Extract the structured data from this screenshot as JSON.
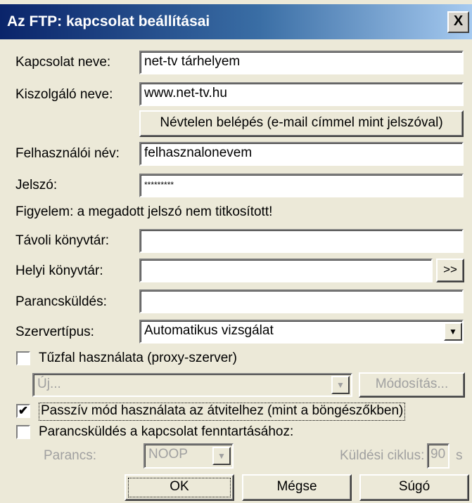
{
  "window": {
    "title": "Az FTP: kapcsolat beállításai",
    "close_label": "X"
  },
  "form": {
    "connection_name": {
      "label": "Kapcsolat neve:",
      "value": "net-tv tárhelyem"
    },
    "server_name": {
      "label": "Kiszolgáló neve:",
      "value": "www.net-tv.hu"
    },
    "anonymous_button": "Névtelen belépés (e-mail címmel mint jelszóval)",
    "username": {
      "label": "Felhasználói név:",
      "value": "felhasznalonevem"
    },
    "password": {
      "label": "Jelszó:",
      "value": "*********"
    },
    "warning": "Figyelem: a megadott jelszó nem titkosított!",
    "remote_dir": {
      "label": "Távoli könyvtár:",
      "value": ""
    },
    "local_dir": {
      "label": "Helyi könyvtár:",
      "value": "",
      "browse_label": ">>"
    },
    "command": {
      "label": "Parancsküldés:",
      "value": ""
    },
    "server_type": {
      "label": "Szervertípus:",
      "value": "Automatikus vizsgálat"
    },
    "firewall": {
      "label": "Tűzfal használata (proxy-szerver)",
      "checked": false,
      "profile_value": "Új...",
      "modify_label": "Módosítás..."
    },
    "passive": {
      "label": "Passzív mód használata az átvitelhez (mint a böngészőkben)",
      "checked": true
    },
    "keepalive": {
      "label": "Parancsküldés a kapcsolat fenntartásához:",
      "checked": false,
      "command_label": "Parancs:",
      "command_value": "NOOP",
      "cycle_label": "Küldési ciklus:",
      "cycle_value": "90",
      "unit": "s"
    }
  },
  "buttons": {
    "ok": "OK",
    "cancel": "Mégse",
    "help": "Súgó"
  },
  "icons": {
    "check": "✔",
    "dropdown": "▼"
  }
}
